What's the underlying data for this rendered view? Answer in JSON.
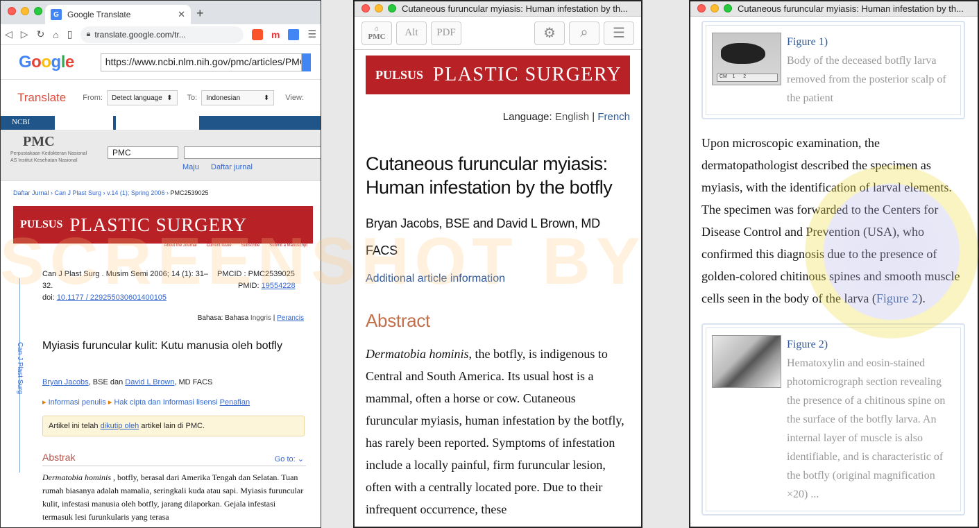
{
  "w1": {
    "tab_title": "Google Translate",
    "url": "translate.google.com/tr...",
    "gt_input_url": "https://www.ncbi.nlm.nih.gov/pmc/articles/PMC25",
    "translate_label": "Translate",
    "from_label": "From:",
    "from_value": "Detect language",
    "to_label": "To:",
    "to_value": "Indonesian",
    "view_label": "View:",
    "ncbi": "NCBI",
    "pmc_logo": "PMC",
    "pmc_sub": "Perpustakaan Kedokteran Nasional AS Institut Kesehatan Nasional",
    "pmc_select": "PMC",
    "link_go": "Maju",
    "link_journals": "Daftar jurnal",
    "crumbs": [
      "Daftar Jurnal",
      "Can J Plast Surg",
      "v.14 (1); Spring 2006",
      "PMC2539025"
    ],
    "banner_pulsus": "PULSUS",
    "banner_title": "PLASTIC SURGERY",
    "banner_links": [
      "About the Journal",
      "Current Issue",
      "Subscribe",
      "Submit a Manuscript"
    ],
    "side_label": "Can J Plast Surg",
    "citation": "Can J Plast Surg . Musim Semi 2006; 14 (1): 31–32.",
    "doi_label": "doi:",
    "doi_value": "10.1177 / 229255030601400105",
    "pmcid": "PMCID : PMC2539025",
    "pmid_label": "PMID:",
    "pmid_value": "19554228",
    "lang_label": "Bahasa: Bahasa",
    "lang_en": "Inggris",
    "lang_fr": "Perancis",
    "title": "Myiasis furuncular kulit: Kutu manusia oleh botfly",
    "author1": "Bryan Jacobs",
    "author_mid": ", BSE dan",
    "author2": "David L Brown",
    "author_end": ", MD FACS",
    "info_a": "Informasi penulis",
    "info_b": "Hak cipta dan Informasi lisensi",
    "info_c": "Penafian",
    "notice_a": "Artikel ini telah",
    "notice_link": "dikutip oleh",
    "notice_b": "artikel lain di PMC.",
    "abstrak": "Abstrak",
    "goto": "Go to:",
    "ab_italic": "Dermatobia hominis",
    "ab_text": " , botfly, berasal dari Amerika Tengah dan Selatan. Tuan rumah biasanya adalah mamalia, seringkali kuda atau sapi. Myiasis furuncular kulit, infestasi manusia oleh botfly, jarang dilaporkan. Gejala infestasi termasuk lesi furunkularis yang terasa"
  },
  "w2": {
    "window_title": "Cutaneous furuncular myiasis: Human infestation by th...",
    "btn_pmc": "PMC",
    "btn_alt": "Alt",
    "btn_pdf": "PDF",
    "banner_pulsus": "PULSUS",
    "banner_title": "PLASTIC SURGERY",
    "lang_label": "Language:",
    "lang_en": "English",
    "lang_sep": "|",
    "lang_fr": "French",
    "title": "Cutaneous furuncular myiasis: Human infestation by the botfly",
    "authors": "Bryan Jacobs, BSE and David L Brown, MD FACS",
    "additional": "Additional article information",
    "abstract_heading": "Abstract",
    "abs_italic": "Dermatobia hominis",
    "abs_text": ", the botfly, is indigenous to Central and South America. Its usual host is a mammal, often a horse or cow. Cutaneous furuncular myiasis, human infestation by the botfly, has rarely been reported. Symptoms of infestation include a locally painful, firm furuncular lesion, often with a centrally located pore. Due to their infrequent occurrence, these"
  },
  "w3": {
    "window_title": "Cutaneous furuncular myiasis: Human infestation by th...",
    "fig1_label": "Figure 1)",
    "fig1_caption": "Body of the deceased botfly larva removed from the posterior scalp of the patient",
    "body_a": "Upon microscopic examination, the dermatopathologist described the specimen as myiasis, with the identification of larval elements. The specimen was forwarded to the Centers for Disease Control and Prevention (USA), who confirmed this diagnosis due to the presence of golden-colored chitinous spines and smooth muscle cells seen in the body of the larva (",
    "body_link": "Figure 2",
    "body_b": ").",
    "fig2_label": "Figure 2)",
    "fig2_caption": "Hematoxylin and eosin-stained photomicrograph section revealing the presence of a chitinous spine on the surface of the botfly larva. An internal layer of muscle is also identifiable, and is characteristic of the botfly (original magnification ×20) ..."
  },
  "watermark": "SCREENSHOT BY"
}
